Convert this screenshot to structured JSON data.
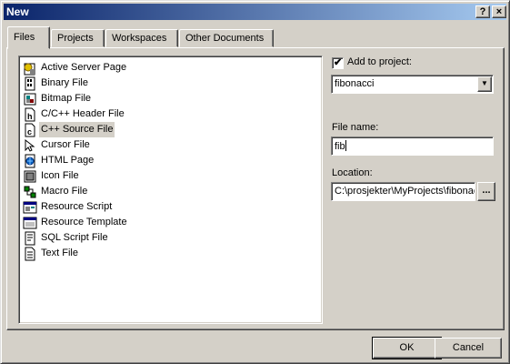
{
  "window": {
    "title": "New",
    "help_glyph": "?",
    "close_glyph": "×"
  },
  "tabs": [
    {
      "label": "Files",
      "active": true
    },
    {
      "label": "Projects",
      "active": false
    },
    {
      "label": "Workspaces",
      "active": false
    },
    {
      "label": "Other Documents",
      "active": false
    }
  ],
  "file_types": [
    {
      "label": "Active Server Page",
      "icon": "asp-icon"
    },
    {
      "label": "Binary File",
      "icon": "binary-file-icon"
    },
    {
      "label": "Bitmap File",
      "icon": "bitmap-icon"
    },
    {
      "label": "C/C++ Header File",
      "icon": "header-file-icon"
    },
    {
      "label": "C++ Source File",
      "icon": "cpp-source-icon",
      "selected": true
    },
    {
      "label": "Cursor File",
      "icon": "cursor-icon"
    },
    {
      "label": "HTML Page",
      "icon": "html-page-icon"
    },
    {
      "label": "Icon File",
      "icon": "icon-file-icon"
    },
    {
      "label": "Macro File",
      "icon": "macro-icon"
    },
    {
      "label": "Resource Script",
      "icon": "resource-script-icon"
    },
    {
      "label": "Resource Template",
      "icon": "resource-template-icon"
    },
    {
      "label": "SQL Script File",
      "icon": "sql-script-icon"
    },
    {
      "label": "Text File",
      "icon": "text-file-icon"
    }
  ],
  "add_to_project": {
    "label": "Add to project:",
    "checked": true,
    "check_glyph": "✔",
    "project": "fibonacci",
    "dropdown_glyph": "▼"
  },
  "file_name": {
    "label": "File name:",
    "value": "fib"
  },
  "location": {
    "label": "Location:",
    "value": "C:\\prosjekter\\MyProjects\\fibonacci",
    "browse_label": "..."
  },
  "buttons": {
    "ok": "OK",
    "cancel": "Cancel"
  }
}
